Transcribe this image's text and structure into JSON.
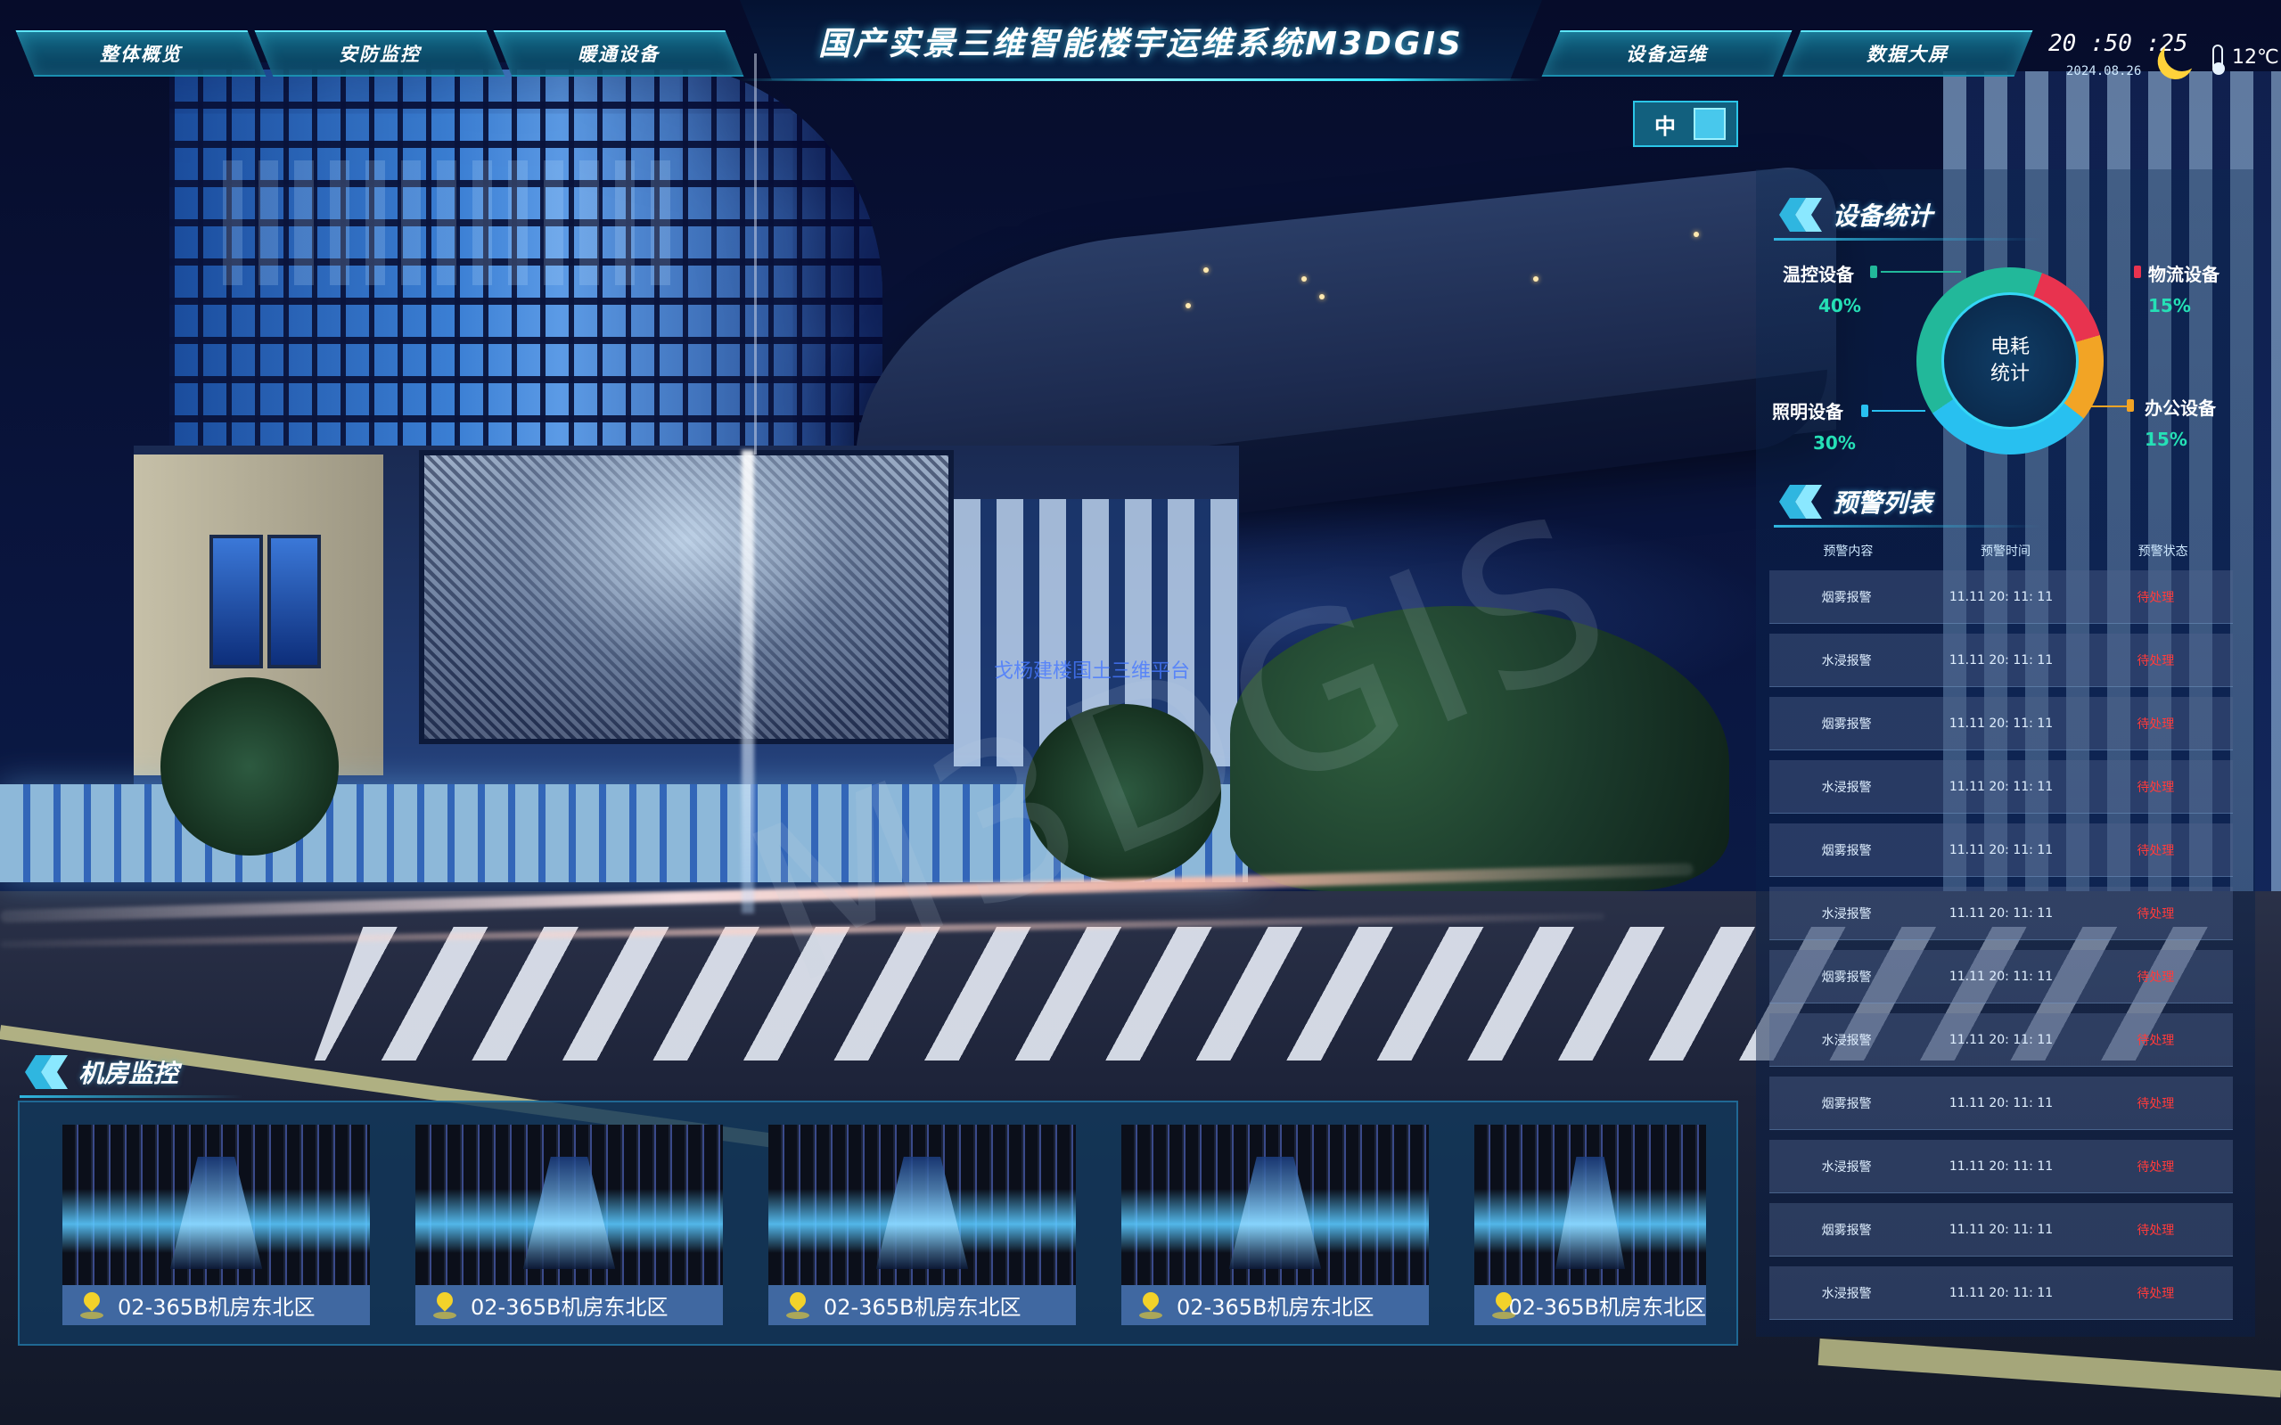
{
  "header": {
    "title": "国产实景三维智能楼宇运维系统M3DGIS",
    "nav_left": [
      "整体概览",
      "安防监控",
      "暖通设备"
    ],
    "nav_right": [
      "设备运维",
      "数据大屏"
    ],
    "time": "20 :50 :25",
    "date": "2024.08.26",
    "weather_icon": "moon-icon",
    "temperature": "12℃",
    "toggle_label": "中"
  },
  "scene": {
    "watermark": "M3DGIS",
    "overlay_text": "戈杨建楼国土三维平台"
  },
  "device_stats": {
    "title": "设备统计",
    "center_label": "电耗统计",
    "chart_data": {
      "type": "pie",
      "categories": [
        "温控设备",
        "照明设备",
        "物流设备",
        "办公设备"
      ],
      "values": [
        40,
        30,
        15,
        15
      ],
      "colors": [
        "#22b89a",
        "#28c0f0",
        "#e8334f",
        "#f2a425"
      ]
    },
    "items": [
      {
        "name": "温控设备",
        "pct": "40%"
      },
      {
        "name": "照明设备",
        "pct": "30%"
      },
      {
        "name": "物流设备",
        "pct": "15%"
      },
      {
        "name": "办公设备",
        "pct": "15%"
      }
    ]
  },
  "alerts": {
    "title": "预警列表",
    "columns": [
      "预警内容",
      "预警时间",
      "预警状态"
    ],
    "rows": [
      {
        "content": "烟雾报警",
        "time": "11.11 20:  11:  11",
        "status": "待处理"
      },
      {
        "content": "水浸报警",
        "time": "11.11 20:  11:  11",
        "status": "待处理"
      },
      {
        "content": "烟雾报警",
        "time": "11.11 20:  11:  11",
        "status": "待处理"
      },
      {
        "content": "水浸报警",
        "time": "11.11 20:  11:  11",
        "status": "待处理"
      },
      {
        "content": "烟雾报警",
        "time": "11.11 20:  11:  11",
        "status": "待处理"
      },
      {
        "content": "水浸报警",
        "time": "11.11 20:  11:  11",
        "status": "待处理"
      },
      {
        "content": "烟雾报警",
        "time": "11.11 20:  11:  11",
        "status": "待处理"
      },
      {
        "content": "水浸报警",
        "time": "11.11 20:  11:  11",
        "status": "待处理"
      },
      {
        "content": "烟雾报警",
        "time": "11.11 20:  11:  11",
        "status": "待处理"
      },
      {
        "content": "水浸报警",
        "time": "11.11 20:  11:  11",
        "status": "待处理"
      },
      {
        "content": "烟雾报警",
        "time": "11.11 20:  11:  11",
        "status": "待处理"
      },
      {
        "content": "水浸报警",
        "time": "11.11 20:  11:  11",
        "status": "待处理"
      }
    ]
  },
  "server_room": {
    "title": "机房监控",
    "cameras": [
      {
        "label": "02-365B机房东北区"
      },
      {
        "label": "02-365B机房东北区"
      },
      {
        "label": "02-365B机房东北区"
      },
      {
        "label": "02-365B机房东北区"
      },
      {
        "label": "02-365B机房东北区"
      }
    ]
  }
}
